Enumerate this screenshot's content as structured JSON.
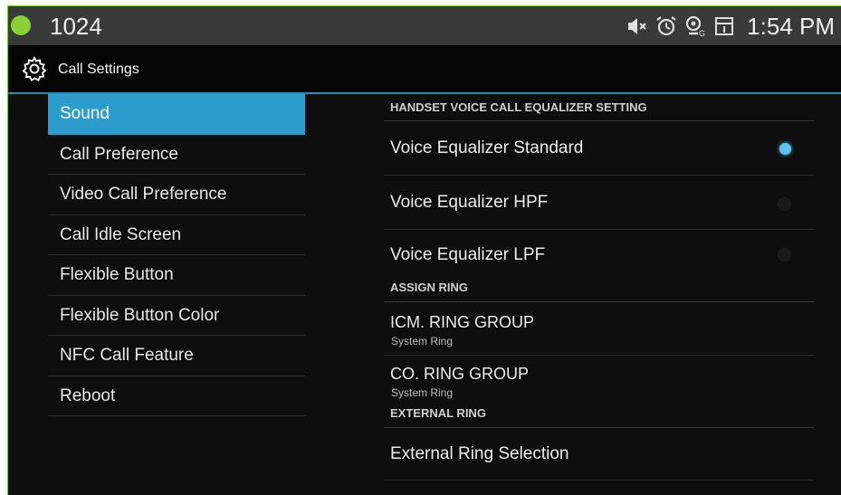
{
  "statusbar": {
    "number": "1024",
    "time": "1:54 PM",
    "icons": [
      "mute-icon",
      "alarm-icon",
      "sim-location-icon",
      "screen-icon"
    ],
    "accent": "#86d133"
  },
  "actionbar": {
    "title": "Call Settings",
    "icon": "gear-icon"
  },
  "menu": {
    "items": [
      {
        "label": "Sound",
        "selected": true
      },
      {
        "label": "Call Preference"
      },
      {
        "label": "Video Call Preference"
      },
      {
        "label": "Call Idle Screen"
      },
      {
        "label": "Flexible Button"
      },
      {
        "label": "Flexible Button Color"
      },
      {
        "label": "NFC Call Feature"
      },
      {
        "label": "Reboot"
      }
    ],
    "selected_color": "#2b9ccc"
  },
  "panel": {
    "eq_header": "HANDSET VOICE CALL EQUALIZER SETTING",
    "eq_options": [
      {
        "label": "Voice Equalizer Standard",
        "checked": true
      },
      {
        "label": "Voice Equalizer HPF",
        "checked": false
      },
      {
        "label": "Voice Equalizer LPF",
        "checked": false
      }
    ],
    "ring_header": "ASSIGN RING",
    "ring_options": [
      {
        "label": "ICM. RING GROUP",
        "sub": "System Ring"
      },
      {
        "label": "CO. RING GROUP",
        "sub": "System Ring"
      }
    ],
    "ext_header": "EXTERNAL RING",
    "ext_option": "External Ring Selection"
  }
}
